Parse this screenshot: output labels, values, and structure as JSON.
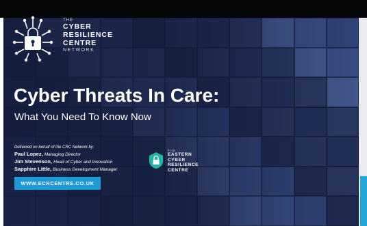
{
  "colors": {
    "slide_background": "#1a2647",
    "accent_blue": "#1e9ad6",
    "text": "#ffffff"
  },
  "crcn_logo": {
    "the": "THE",
    "lines": [
      "CYBER",
      "RESILIENCE",
      "CENTRE"
    ],
    "network": "NETWORK",
    "icon": "circuit-padlock-icon"
  },
  "slide": {
    "title": "Cyber Threats In Care:",
    "subtitle": "What You Need To Know Now"
  },
  "credits": {
    "intro": "Delivered on behalf of the CRC Network by:",
    "people": [
      {
        "name": "Paul Lopez,",
        "role": "Managing Director"
      },
      {
        "name": "Jim Stevenson,",
        "role": "Head of Cyber and Innovation"
      },
      {
        "name": "Sapphire Little,",
        "role": "Business Development Manager"
      }
    ]
  },
  "ecrc_logo": {
    "the": "THE",
    "lines": [
      "EASTERN",
      "CYBER",
      "RESILIENCE",
      "CENTRE"
    ],
    "icon": "padlock-badge-icon"
  },
  "website_button": {
    "label": "WWW.ECRCENTRE.CO.UK"
  }
}
